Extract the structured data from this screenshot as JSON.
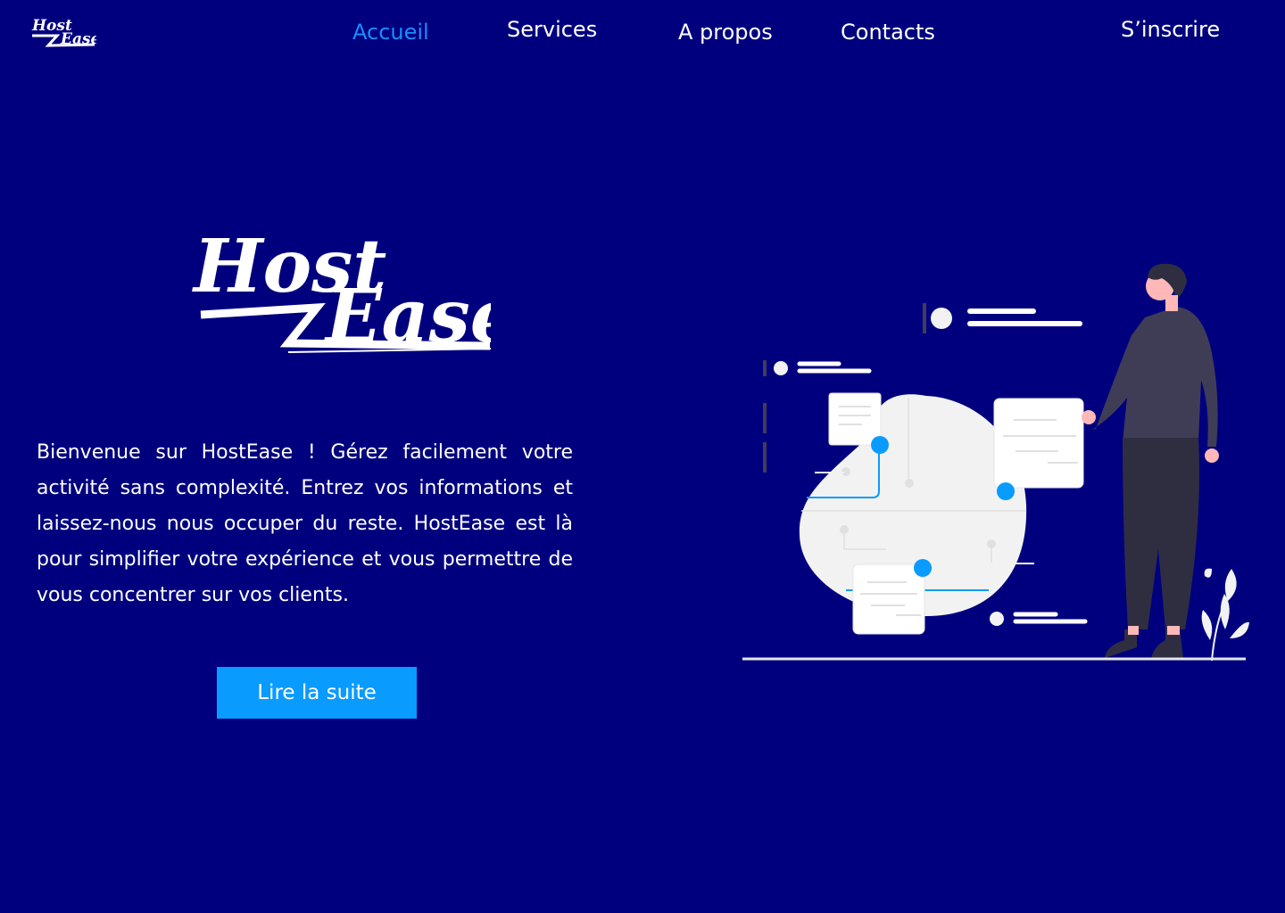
{
  "nav": {
    "logo_text": [
      "Host",
      "Ease"
    ],
    "items": [
      {
        "label": "Accueil",
        "active": true
      },
      {
        "label": "Services",
        "active": false
      },
      {
        "label": "A propos",
        "active": false
      },
      {
        "label": "Contacts",
        "active": false
      }
    ],
    "signup_label": "S’inscrire"
  },
  "hero": {
    "logo_text": [
      "Host",
      "Ease"
    ],
    "intro": "Bienvenue sur HostEase ! Gérez facilement votre activité sans complexité. Entrez vos informations et laissez-nous nous occuper du reste. HostEase est là pour simplifier votre expérience et vous permettre de vous concentrer sur vos clients.",
    "cta_label": "Lire la suite"
  },
  "colors": {
    "background": "#00007f",
    "accent": "#0a9bff",
    "active_nav": "#1a8cff",
    "text": "#ffffff"
  },
  "icons": [
    "hostease-logo",
    "person-illustration",
    "plant-icon"
  ]
}
